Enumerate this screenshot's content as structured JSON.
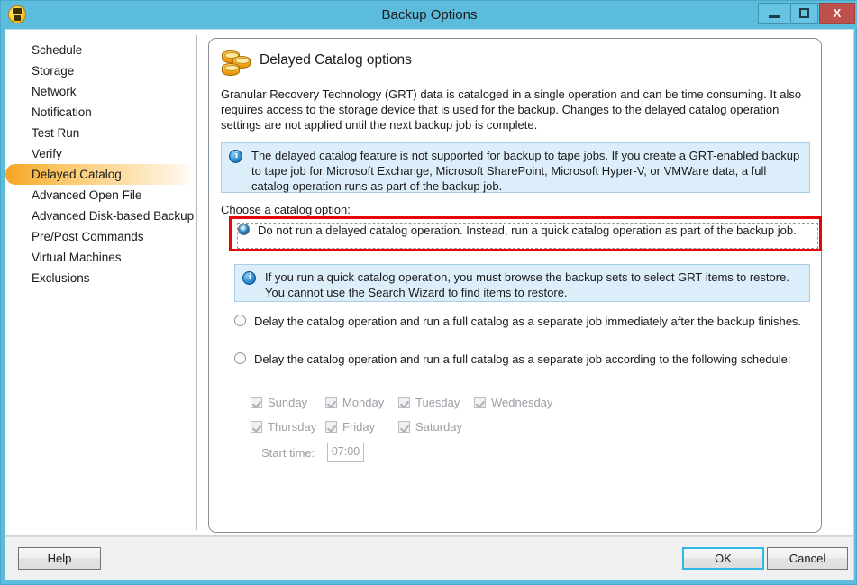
{
  "window": {
    "title": "Backup Options",
    "icon": "backup-app-icon",
    "controls": {
      "minimize": "minimize-icon",
      "maximize": "maximize-icon",
      "close": "X"
    }
  },
  "sidebar": {
    "items": [
      {
        "label": "Schedule",
        "selected": false
      },
      {
        "label": "Storage",
        "selected": false
      },
      {
        "label": "Network",
        "selected": false
      },
      {
        "label": "Notification",
        "selected": false
      },
      {
        "label": "Test Run",
        "selected": false
      },
      {
        "label": "Verify",
        "selected": false
      },
      {
        "label": "Delayed Catalog",
        "selected": true
      },
      {
        "label": "Advanced Open File",
        "selected": false
      },
      {
        "label": "Advanced Disk-based Backup",
        "selected": false
      },
      {
        "label": "Pre/Post Commands",
        "selected": false
      },
      {
        "label": "Virtual Machines",
        "selected": false
      },
      {
        "label": "Exclusions",
        "selected": false
      }
    ]
  },
  "panel": {
    "header_icon": "disk-stack-icon",
    "header_title": "Delayed Catalog options",
    "intro": "Granular Recovery Technology (GRT) data is cataloged in a single operation and can be time consuming. It also requires access to the storage device that is used for the backup. Changes to the delayed catalog operation settings are not applied until the next backup job is complete.",
    "info_1": "The delayed catalog feature is not supported for backup to tape jobs. If you create a GRT-enabled backup to tape job for Microsoft Exchange, Microsoft SharePoint, Microsoft Hyper-V, or VMWare data, a full catalog operation runs as part of the backup job.",
    "info_2": "If you run a quick catalog operation, you must browse the backup sets to select GRT items to restore. You cannot use the Search Wizard to find items to restore.",
    "choose_label": "Choose a catalog option:",
    "options": [
      {
        "label": "Do not run a delayed catalog operation. Instead, run a quick catalog operation as part of the backup job.",
        "selected": true,
        "highlighted": true
      },
      {
        "label": "Delay the catalog operation and run a full catalog as a separate job immediately after the backup finishes.",
        "selected": false,
        "highlighted": false
      },
      {
        "label": "Delay the catalog operation and run a full catalog as a separate job according to the following schedule:",
        "selected": false,
        "highlighted": false
      }
    ],
    "days": [
      {
        "label": "Sunday",
        "checked": true,
        "disabled": true
      },
      {
        "label": "Monday",
        "checked": true,
        "disabled": true
      },
      {
        "label": "Tuesday",
        "checked": true,
        "disabled": true
      },
      {
        "label": "Wednesday",
        "checked": true,
        "disabled": true
      },
      {
        "label": "Thursday",
        "checked": true,
        "disabled": true
      },
      {
        "label": "Friday",
        "checked": true,
        "disabled": true
      },
      {
        "label": "Saturday",
        "checked": true,
        "disabled": true
      }
    ],
    "start_time_label": "Start time:",
    "start_time_value": "07:00"
  },
  "footer": {
    "help": "Help",
    "ok": "OK",
    "cancel": "Cancel"
  },
  "colors": {
    "titlebar": "#5bbcdd",
    "close_button": "#c0504d",
    "selection_highlight": "#f6a623",
    "info_background": "#ddeefb",
    "highlight_outline": "#e8060b",
    "focus_outline": "#2fb8e6"
  }
}
